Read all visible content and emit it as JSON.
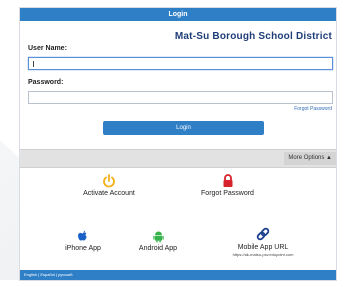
{
  "header": {
    "title": "Login"
  },
  "district": {
    "name": "Mat-Su Borough School District"
  },
  "form": {
    "username_label": "User Name:",
    "password_label": "Password:",
    "username_value": "",
    "password_value": "",
    "forgot_link": "Forgot Password",
    "login_button": "Login"
  },
  "options": {
    "more_options_label": "More Options"
  },
  "actions": {
    "activate_account": "Activate Account",
    "forgot_password": "Forgot Password",
    "iphone_app": "iPhone App",
    "android_app": "Android App",
    "mobile_app_url": "Mobile App URL",
    "mobile_app_url_value": "https://ak-matsu-psv.edupoint.com"
  },
  "footer": {
    "languages": "English | Español | русский"
  },
  "colors": {
    "brand_blue": "#2f7fc6",
    "district_navy": "#1e3d78",
    "activate_yellow": "#f3b11a",
    "lock_red": "#d6222a",
    "android_green": "#35b24a",
    "apple_blue": "#1b62c8"
  },
  "icons": [
    "power-icon",
    "lock-icon",
    "apple-icon",
    "android-icon",
    "link-icon",
    "chevron-up-icon"
  ]
}
